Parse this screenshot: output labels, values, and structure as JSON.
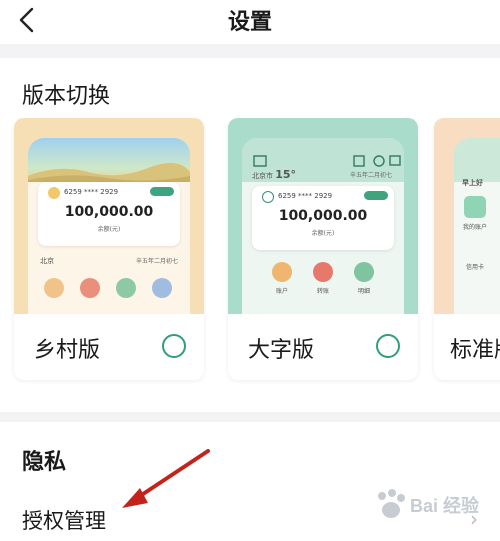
{
  "header": {
    "title": "设置"
  },
  "version_section": {
    "title": "版本切换"
  },
  "cards": [
    {
      "label": "乡村版",
      "account_no": "6259 **** 2929",
      "balance": "100,000.00",
      "balance_sub": "余额(元)",
      "weather_city": "北京",
      "date_text": "辛五年二月初七"
    },
    {
      "label": "大字版",
      "account_no": "6259 **** 2929",
      "balance": "100,000.00",
      "balance_sub": "余额(元)",
      "weather_city": "北京市",
      "weather_temp": "15°",
      "date_text": "辛五年二月初七",
      "features": [
        "账户",
        "转账",
        "明细"
      ]
    },
    {
      "label": "标准版",
      "greeting": "早上好",
      "features": [
        "我的账户",
        "信用卡"
      ]
    }
  ],
  "privacy_section": {
    "title": "隐私"
  },
  "auth_row": {
    "label": "授权管理"
  },
  "watermark": {
    "text": "Bai 经验"
  },
  "colors": {
    "rural_bg": "#f7dfb5",
    "large_bg": "#a9dccb",
    "standard_bg": "#f8ddc3",
    "accent_green": "#2f9e7a",
    "arrow_red": "#c4231c",
    "divider": "#f3f3f5"
  },
  "icons": {
    "back": "chevron-left-icon",
    "auth_chevron": "chevron-right-icon",
    "radio": "radio-empty-icon"
  }
}
